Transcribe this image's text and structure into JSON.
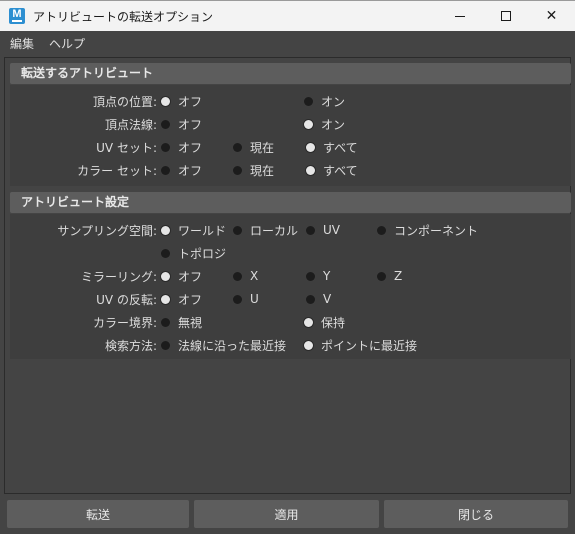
{
  "window": {
    "title": "アトリビュートの転送オプション",
    "icon": "maya-app-icon",
    "icon_letter": "M"
  },
  "menu": [
    "編集",
    "ヘルプ"
  ],
  "section1": {
    "title": "転送するアトリビュート",
    "rows": [
      {
        "label": "頂点の位置:",
        "options": [
          "オフ",
          "オン"
        ],
        "selected": "オフ"
      },
      {
        "label": "頂点法線:",
        "options": [
          "オフ",
          "オン"
        ],
        "selected": "オン"
      },
      {
        "label": "UV セット:",
        "options": [
          "オフ",
          "現在",
          "すべて"
        ],
        "selected": "すべて"
      },
      {
        "label": "カラー セット:",
        "options": [
          "オフ",
          "現在",
          "すべて"
        ],
        "selected": "すべて"
      }
    ]
  },
  "section2": {
    "title": "アトリビュート設定",
    "rows": [
      {
        "label": "サンプリング空間:",
        "options": [
          "ワールド",
          "ローカル",
          "UV",
          "コンポーネント",
          "トポロジ"
        ],
        "selected": "ワールド"
      },
      {
        "label": "ミラーリング:",
        "options": [
          "オフ",
          "X",
          "Y",
          "Z"
        ],
        "selected": "オフ"
      },
      {
        "label": "UV の反転:",
        "options": [
          "オフ",
          "U",
          "V"
        ],
        "selected": "オフ"
      },
      {
        "label": "カラー境界:",
        "options": [
          "無視",
          "保持"
        ],
        "selected": "保持"
      },
      {
        "label": "検索方法:",
        "options": [
          "法線に沿った最近接",
          "ポイントに最近接"
        ],
        "selected": "ポイントに最近接"
      }
    ]
  },
  "buttons": {
    "transfer": "転送",
    "apply": "適用",
    "close": "閉じる"
  },
  "colors": {
    "background": "#444444",
    "section_header": "#5d5d5d",
    "section_body": "#3e3e3e",
    "titlebar": "#f3f3f3",
    "accent": "#2d8fd1"
  }
}
